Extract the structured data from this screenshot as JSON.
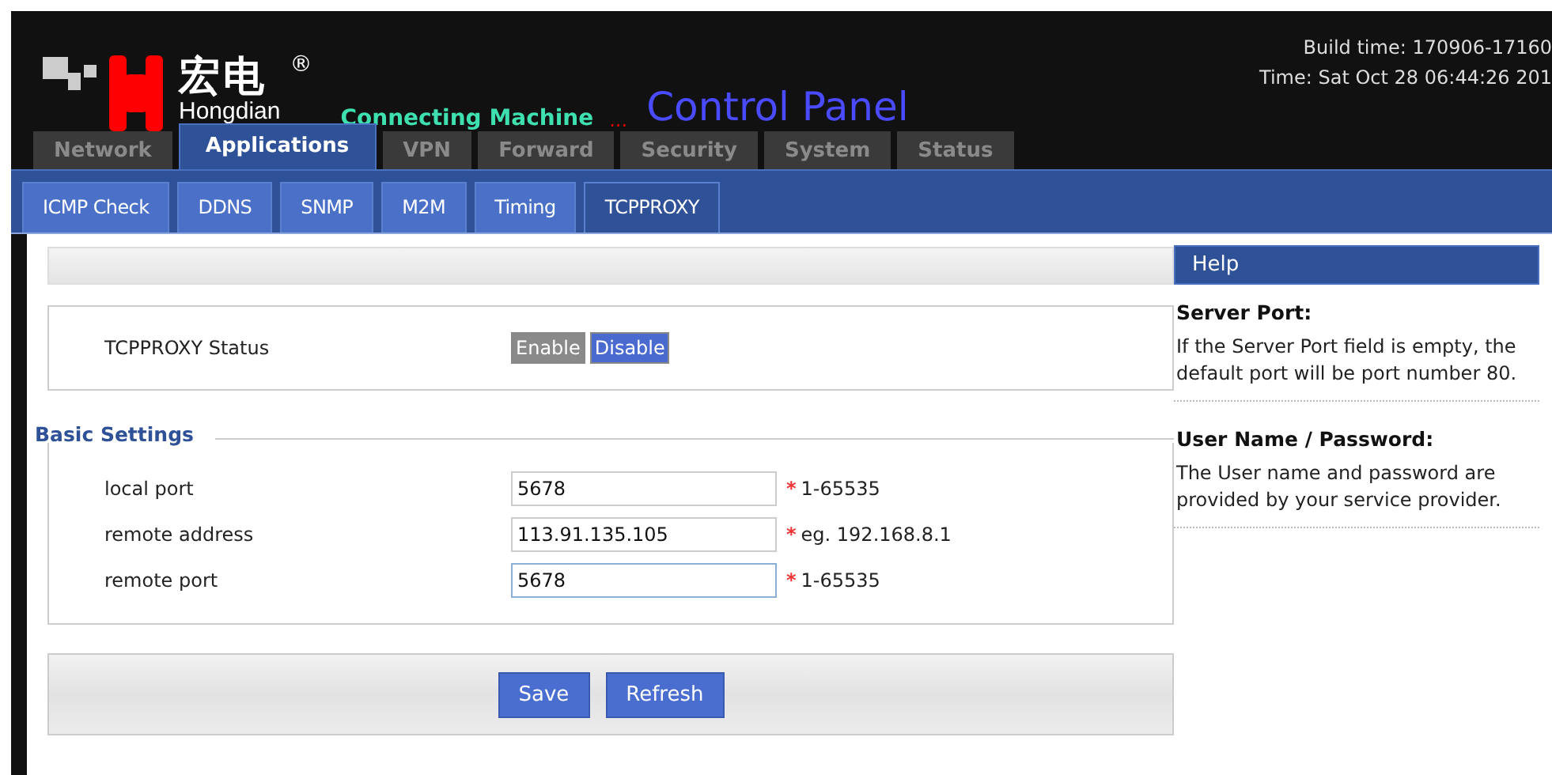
{
  "header": {
    "brand_cn": "宏电",
    "registered": "®",
    "brand_en": "Hongdian",
    "tagline": "Connecting Machine",
    "ellipsis": "...",
    "title": "Control Panel",
    "build_time": "Build time: 170906-17160",
    "time": "Time: Sat Oct 28 06:44:26 201"
  },
  "tabs": [
    {
      "label": "Network",
      "selected": false
    },
    {
      "label": "Applications",
      "selected": true
    },
    {
      "label": "VPN",
      "selected": false
    },
    {
      "label": "Forward",
      "selected": false
    },
    {
      "label": "Security",
      "selected": false
    },
    {
      "label": "System",
      "selected": false
    },
    {
      "label": "Status",
      "selected": false
    }
  ],
  "subtabs": [
    {
      "label": "ICMP Check",
      "selected": false
    },
    {
      "label": "DDNS",
      "selected": false
    },
    {
      "label": "SNMP",
      "selected": false
    },
    {
      "label": "M2M",
      "selected": false
    },
    {
      "label": "Timing",
      "selected": false
    },
    {
      "label": "TCPPROXY",
      "selected": true
    }
  ],
  "status": {
    "label": "TCPPROXY Status",
    "options": [
      {
        "label": "Enable",
        "selected": false
      },
      {
        "label": "Disable",
        "selected": true
      }
    ]
  },
  "basic_settings": {
    "title": "Basic Settings",
    "fields": [
      {
        "label": "local port",
        "value": "5678",
        "mark": "*",
        "hint": "1-65535",
        "focused": false
      },
      {
        "label": "remote address",
        "value": "113.91.135.105",
        "mark": "*",
        "hint": "eg. 192.168.8.1",
        "focused": false
      },
      {
        "label": "remote port",
        "value": "5678",
        "mark": "*",
        "hint": "1-65535",
        "focused": true
      }
    ]
  },
  "buttons": [
    "Save",
    "Refresh"
  ],
  "help": {
    "title": "Help",
    "entries": [
      {
        "heading": "Server Port:",
        "text": "If the Server Port field is empty, the default port will be port number 80."
      },
      {
        "heading": "User Name / Password:",
        "text": "The User name and password are provided by your service provider."
      }
    ]
  }
}
